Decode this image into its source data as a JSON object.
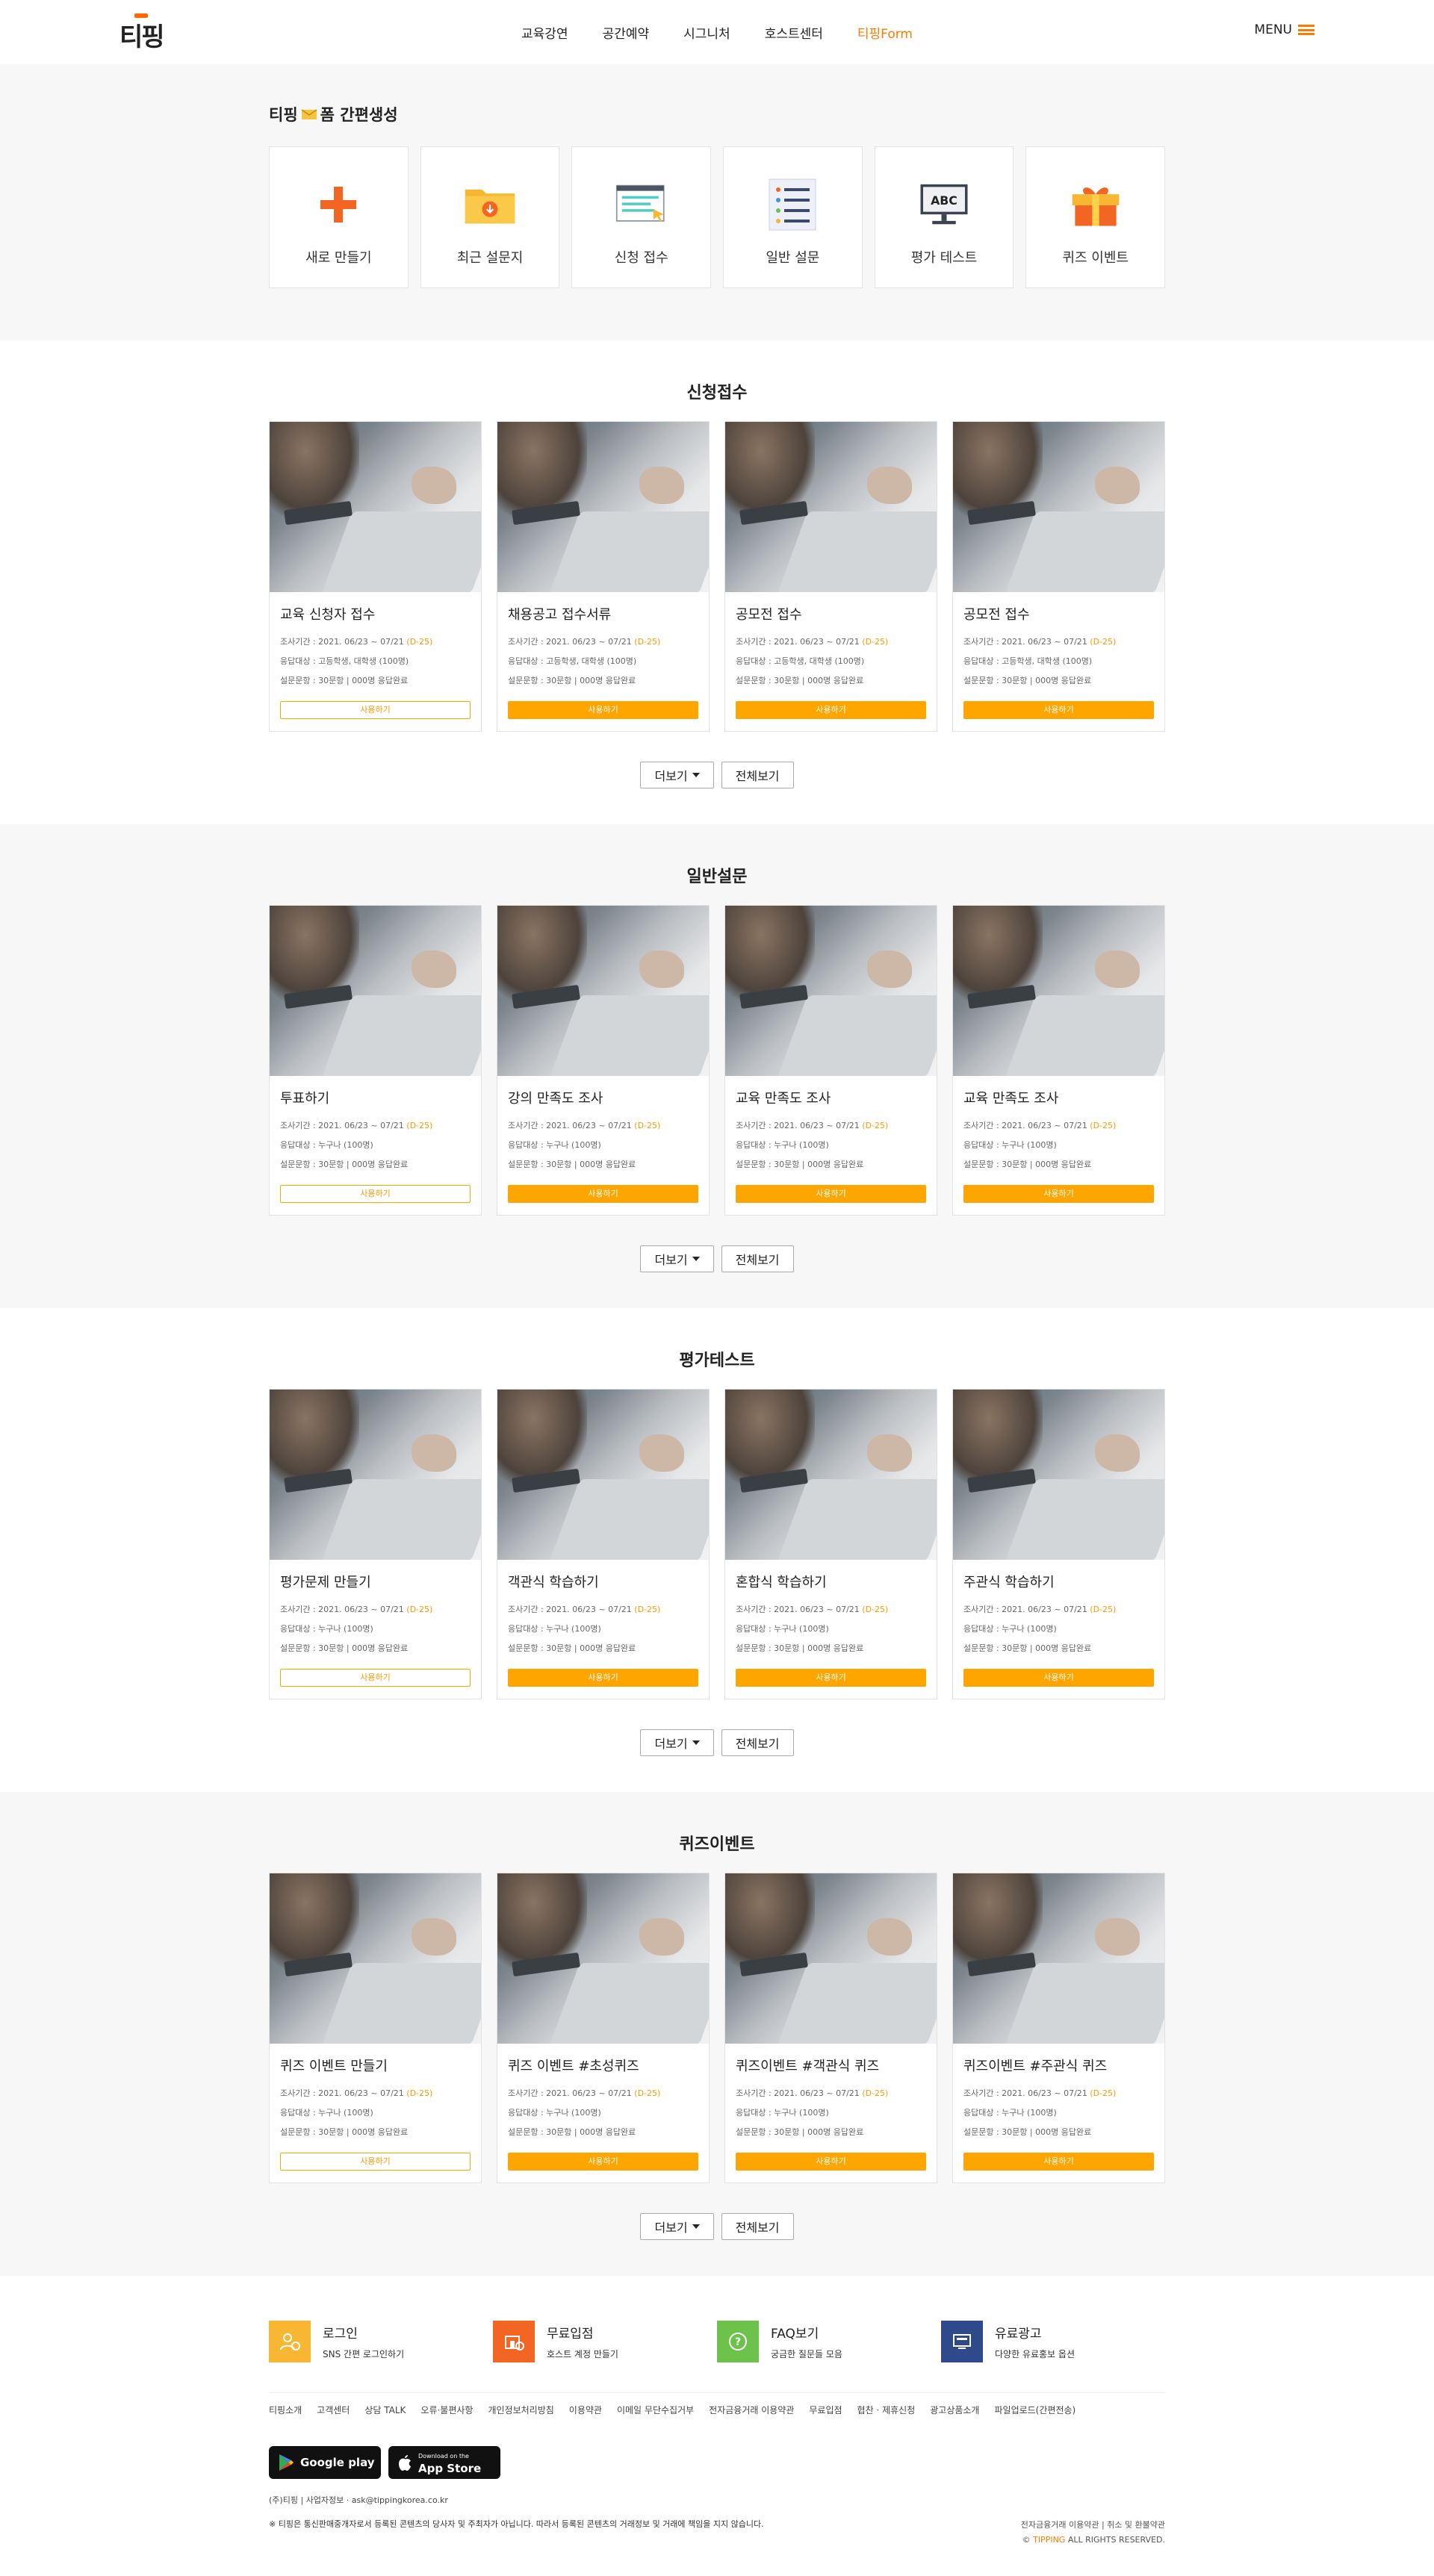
{
  "header": {
    "logo": "티핑",
    "nav": [
      "교육강연",
      "공간예약",
      "시그니처",
      "호스트센터",
      "티핑Form"
    ],
    "active_nav": "티핑Form",
    "menu_label": "MENU"
  },
  "quick": {
    "title_prefix": "티핑",
    "title_suffix": "폼 간편생성",
    "items": [
      {
        "label": "새로 만들기",
        "icon": "plus-icon"
      },
      {
        "label": "최근 설문지",
        "icon": "folder-download-icon"
      },
      {
        "label": "신청 접수",
        "icon": "document-cursor-icon"
      },
      {
        "label": "일반 설문",
        "icon": "list-icon"
      },
      {
        "label": "평가 테스트",
        "icon": "abc-board-icon"
      },
      {
        "label": "퀴즈 이벤트",
        "icon": "gift-icon"
      }
    ]
  },
  "sections": [
    {
      "title": "신청접수",
      "cards": [
        {
          "title": "교육 신청자 접수",
          "period": "조사기간 : 2021. 06/23 ~ 07/21",
          "dday": "(D-25)",
          "target": "응답대상 : 고등학생, 대학생 (100명)",
          "status": "설문문항 : 30문항 | 000명 응답완료",
          "button": "사용하기"
        },
        {
          "title": "채용공고 접수서류",
          "period": "조사기간 : 2021. 06/23 ~ 07/21",
          "dday": "(D-25)",
          "target": "응답대상 : 고등학생, 대학생 (100명)",
          "status": "설문문항 : 30문항 | 000명 응답완료",
          "button": "사용하기"
        },
        {
          "title": "공모전 접수",
          "period": "조사기간 : 2021. 06/23 ~ 07/21",
          "dday": "(D-25)",
          "target": "응답대상 : 고등학생, 대학생 (100명)",
          "status": "설문문항 : 30문항 | 000명 응답완료",
          "button": "사용하기"
        },
        {
          "title": "공모전 접수",
          "period": "조사기간 : 2021. 06/23 ~ 07/21",
          "dday": "(D-25)",
          "target": "응답대상 : 고등학생, 대학생 (100명)",
          "status": "설문문항 : 30문항 | 000명 응답완료",
          "button": "사용하기"
        }
      ]
    },
    {
      "title": "일반설문",
      "cards": [
        {
          "title": "투표하기",
          "period": "조사기간 : 2021. 06/23 ~ 07/21",
          "dday": "(D-25)",
          "target": "응답대상 : 누구나 (100명)",
          "status": "설문문항 : 30문항 | 000명 응답완료",
          "button": "사용하기"
        },
        {
          "title": "강의 만족도 조사",
          "period": "조사기간 : 2021. 06/23 ~ 07/21",
          "dday": "(D-25)",
          "target": "응답대상 : 누구나 (100명)",
          "status": "설문문항 : 30문항 | 000명 응답완료",
          "button": "사용하기"
        },
        {
          "title": "교육 만족도 조사",
          "period": "조사기간 : 2021. 06/23 ~ 07/21",
          "dday": "(D-25)",
          "target": "응답대상 : 누구나 (100명)",
          "status": "설문문항 : 30문항 | 000명 응답완료",
          "button": "사용하기"
        },
        {
          "title": "교육 만족도 조사",
          "period": "조사기간 : 2021. 06/23 ~ 07/21",
          "dday": "(D-25)",
          "target": "응답대상 : 누구나 (100명)",
          "status": "설문문항 : 30문항 | 000명 응답완료",
          "button": "사용하기"
        }
      ]
    },
    {
      "title": "평가테스트",
      "cards": [
        {
          "title": "평가문제 만들기",
          "period": "조사기간 : 2021. 06/23 ~ 07/21",
          "dday": "(D-25)",
          "target": "응답대상 : 누구나 (100명)",
          "status": "설문문항 : 30문항 | 000명 응답완료",
          "button": "사용하기"
        },
        {
          "title": "객관식 학습하기",
          "period": "조사기간 : 2021. 06/23 ~ 07/21",
          "dday": "(D-25)",
          "target": "응답대상 : 누구나 (100명)",
          "status": "설문문항 : 30문항 | 000명 응답완료",
          "button": "사용하기"
        },
        {
          "title": "혼합식 학습하기",
          "period": "조사기간 : 2021. 06/23 ~ 07/21",
          "dday": "(D-25)",
          "target": "응답대상 : 누구나 (100명)",
          "status": "설문문항 : 30문항 | 000명 응답완료",
          "button": "사용하기"
        },
        {
          "title": "주관식 학습하기",
          "period": "조사기간 : 2021. 06/23 ~ 07/21",
          "dday": "(D-25)",
          "target": "응답대상 : 누구나 (100명)",
          "status": "설문문항 : 30문항 | 000명 응답완료",
          "button": "사용하기"
        }
      ]
    },
    {
      "title": "퀴즈이벤트",
      "cards": [
        {
          "title": "퀴즈 이벤트 만들기",
          "period": "조사기간 : 2021. 06/23 ~ 07/21",
          "dday": "(D-25)",
          "target": "응답대상 : 누구나 (100명)",
          "status": "설문문항 : 30문항 | 000명 응답완료",
          "button": "사용하기"
        },
        {
          "title": "퀴즈 이벤트 #초성퀴즈",
          "period": "조사기간 : 2021. 06/23 ~ 07/21",
          "dday": "(D-25)",
          "target": "응답대상 : 누구나 (100명)",
          "status": "설문문항 : 30문항 | 000명 응답완료",
          "button": "사용하기"
        },
        {
          "title": "퀴즈이벤트 #객관식 퀴즈",
          "period": "조사기간 : 2021. 06/23 ~ 07/21",
          "dday": "(D-25)",
          "target": "응답대상 : 누구나 (100명)",
          "status": "설문문항 : 30문항 | 000명 응답완료",
          "button": "사용하기"
        },
        {
          "title": "퀴즈이벤트 #주관식 퀴즈",
          "period": "조사기간 : 2021. 06/23 ~ 07/21",
          "dday": "(D-25)",
          "target": "응답대상 : 누구나 (100명)",
          "status": "설문문항 : 30문항 | 000명 응답완료",
          "button": "사용하기"
        }
      ]
    }
  ],
  "more_label": "더보기",
  "all_label": "전체보기",
  "footer": {
    "services": [
      {
        "title": "로그인",
        "sub": "SNS 간편 로그인하기",
        "color": "#f7b733"
      },
      {
        "title": "무료입점",
        "sub": "호스트 계정 만들기",
        "color": "#f26522"
      },
      {
        "title": "FAQ보기",
        "sub": "궁금한 질문들 모음",
        "color": "#6cc24a"
      },
      {
        "title": "유료광고",
        "sub": "다양한 유료홍보 옵션",
        "color": "#2f4a8a"
      }
    ],
    "links": [
      "티핑소개",
      "고객센터",
      "상담 TALK",
      "오류·불편사항",
      "개인정보처리방침",
      "이용약관",
      "이메일 무단수집거부",
      "전자금융거래 이용약관",
      "무료입점",
      "협찬 · 제휴신청",
      "광고상품소개",
      "파일업로드(간편전송)"
    ],
    "stores": [
      {
        "small": "",
        "name": "Google play"
      },
      {
        "small": "Download on the",
        "name": "App Store"
      }
    ],
    "company": "(주)티핑 | 사업자정보 ·  ask@tippingkorea.co.kr",
    "notice": "※ 티핑은 통신판매중개자로서 등록된 콘텐츠의 당사자 및 주최자가 아닙니다. 따라서 등록된 콘텐츠의 거래정보 및 거래에 책임을 지지 않습니다.",
    "terms": "전자금융거래 이용약관  |  취소 및 환불약관",
    "copy_prefix": "© ",
    "copy_brand": "TIPPING",
    "copy_suffix": " ALL RIGHTS RESERVED."
  }
}
